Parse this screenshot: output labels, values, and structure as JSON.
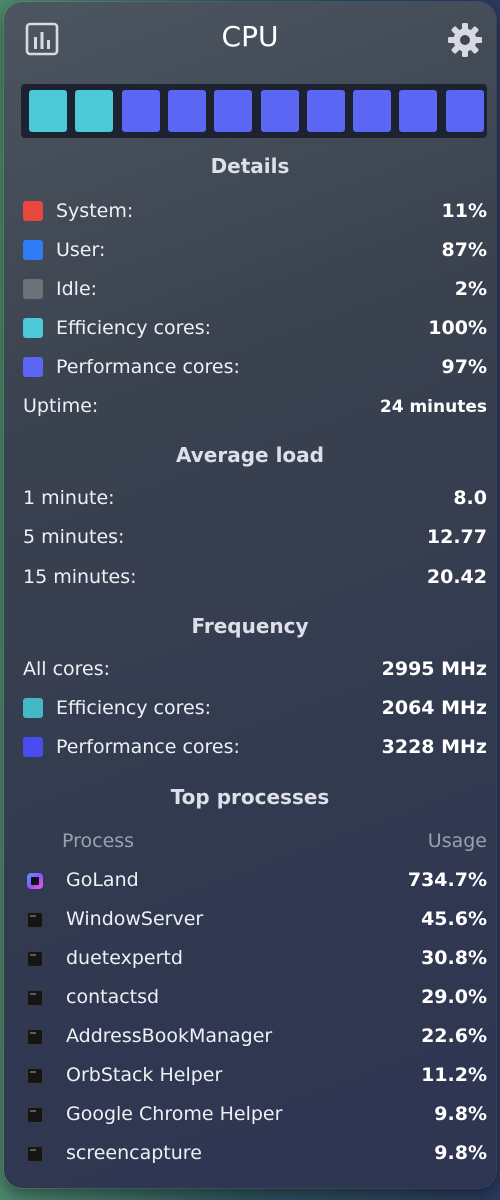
{
  "header": {
    "title": "CPU",
    "left_icon": "chart-icon",
    "right_icon": "gear-icon"
  },
  "core_bars": [
    {
      "type": "efficiency",
      "color": "#4cc9d6"
    },
    {
      "type": "efficiency",
      "color": "#4cc9d6"
    },
    {
      "type": "performance",
      "color": "#5b66f5"
    },
    {
      "type": "performance",
      "color": "#5b66f5"
    },
    {
      "type": "performance",
      "color": "#5b66f5"
    },
    {
      "type": "performance",
      "color": "#5b66f5"
    },
    {
      "type": "performance",
      "color": "#5b66f5"
    },
    {
      "type": "performance",
      "color": "#5b66f5"
    },
    {
      "type": "performance",
      "color": "#5b66f5"
    },
    {
      "type": "performance",
      "color": "#5b66f5"
    }
  ],
  "details": {
    "title": "Details",
    "items": [
      {
        "label": "System:",
        "value": "11%",
        "color": "#e8473e"
      },
      {
        "label": "User:",
        "value": "87%",
        "color": "#2f7df6"
      },
      {
        "label": "Idle:",
        "value": "2%",
        "color": "#6e7177"
      },
      {
        "label": "Efficiency cores:",
        "value": "100%",
        "color": "#4cc9d6"
      },
      {
        "label": "Performance cores:",
        "value": "97%",
        "color": "#5b66f5"
      }
    ],
    "uptime": {
      "label": "Uptime:",
      "value": "24 minutes"
    }
  },
  "average_load": {
    "title": "Average load",
    "items": [
      {
        "label": "1 minute:",
        "value": "8.0"
      },
      {
        "label": "5 minutes:",
        "value": "12.77"
      },
      {
        "label": "15 minutes:",
        "value": "20.42"
      }
    ]
  },
  "frequency": {
    "title": "Frequency",
    "all": {
      "label": "All cores:",
      "value": "2995 MHz"
    },
    "efficiency": {
      "label": "Efficiency cores:",
      "value": "2064 MHz",
      "color": "#45b8c5"
    },
    "performance": {
      "label": "Performance cores:",
      "value": "3228 MHz",
      "color": "#4a4cf0"
    }
  },
  "top_processes": {
    "title": "Top processes",
    "header": {
      "process": "Process",
      "usage": "Usage"
    },
    "rows": [
      {
        "name": "GoLand",
        "usage": "734.7%",
        "icon": "goland-app-icon"
      },
      {
        "name": "WindowServer",
        "usage": "45.6%",
        "icon": "terminal-exec-icon"
      },
      {
        "name": "duetexpertd",
        "usage": "30.8%",
        "icon": "terminal-exec-icon"
      },
      {
        "name": "contactsd",
        "usage": "29.0%",
        "icon": "terminal-exec-icon"
      },
      {
        "name": "AddressBookManager",
        "usage": "22.6%",
        "icon": "terminal-exec-icon"
      },
      {
        "name": "OrbStack Helper",
        "usage": "11.2%",
        "icon": "terminal-exec-icon"
      },
      {
        "name": "Google Chrome Helper",
        "usage": "9.8%",
        "icon": "terminal-exec-icon"
      },
      {
        "name": "screencapture",
        "usage": "9.8%",
        "icon": "terminal-exec-icon"
      }
    ]
  }
}
